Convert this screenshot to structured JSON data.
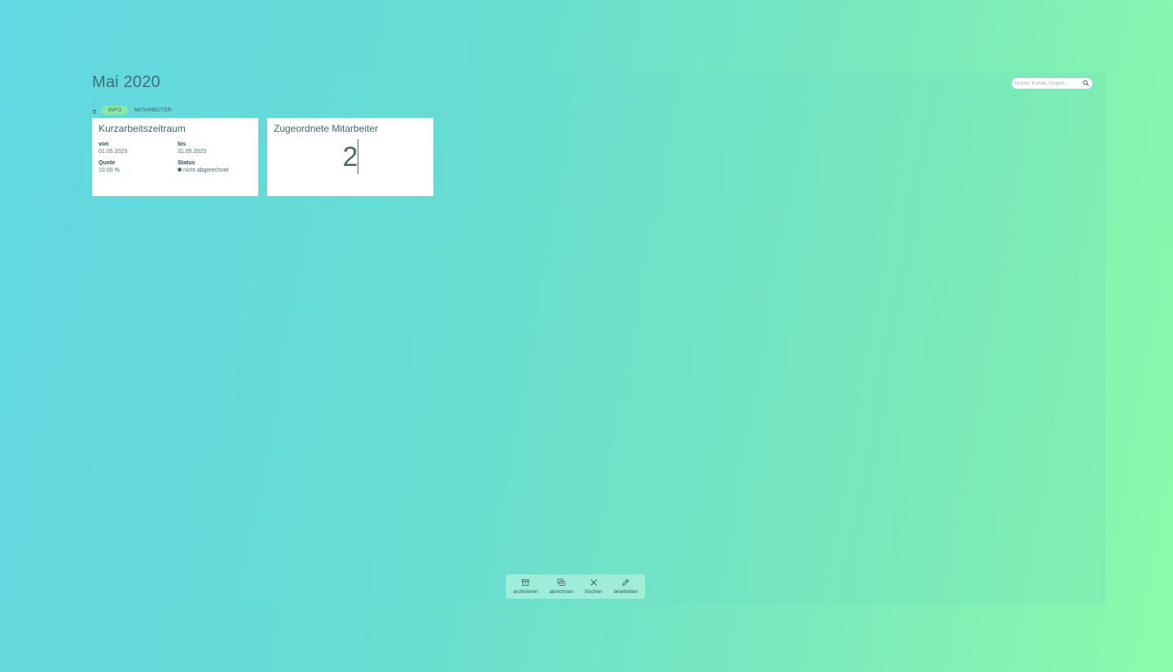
{
  "header": {
    "title": "Mai 2020",
    "search_placeholder": "Nutzer, Kunde, Projekt..."
  },
  "tabs": [
    {
      "label": "INFO",
      "active": true
    },
    {
      "label": "MITARBEITER",
      "active": false
    }
  ],
  "period_card": {
    "title": "Kurzarbeitszeitraum",
    "fields": {
      "from_label": "von",
      "from_value": "01.05.2023",
      "to_label": "bis",
      "to_value": "31.05.2023",
      "quota_label": "Quote",
      "quota_value": "10.00 %",
      "status_label": "Status",
      "status_value": "nicht abgerechnet"
    }
  },
  "employees_card": {
    "title": "Zugeordnete Mitarbeiter",
    "count": "2"
  },
  "toolbar": {
    "archive_label": "archivieren",
    "bill_label": "abrechnen",
    "delete_label": "löschen",
    "edit_label": "bearbeiten"
  },
  "icons": {
    "search": "search-icon",
    "collapse": "chevron-up-icon",
    "archive": "archive-box-icon",
    "bill": "invoice-icon",
    "delete": "close-icon",
    "edit": "pencil-icon"
  },
  "colors": {
    "active_tab": "#8ae9a8",
    "text": "#3b6670"
  }
}
